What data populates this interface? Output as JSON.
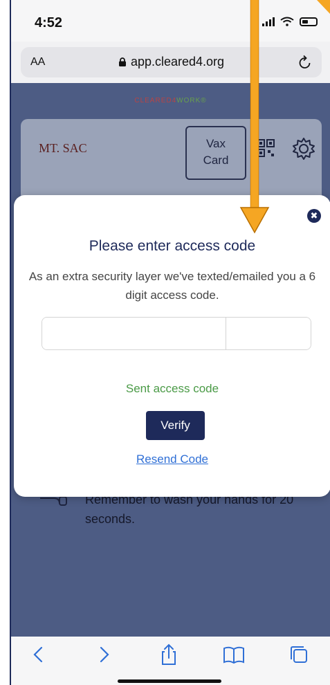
{
  "status_bar": {
    "time": "4:52"
  },
  "url_bar": {
    "text_size_label": "AA",
    "domain": "app.cleared4.org"
  },
  "page": {
    "brand": {
      "part1": "CLEARED4",
      "part2": "WORK",
      "mark": "®"
    },
    "logo": {
      "text": "MT. SAC"
    },
    "vax_card": {
      "line1": "Vax",
      "line2": "Card"
    },
    "tip": "Remember to wash your hands for 20 seconds."
  },
  "modal": {
    "close_glyph": "✖",
    "title": "Please enter access code",
    "subtitle": "As an extra security layer we've texted/emailed you a 6 digit access code.",
    "code_slots": [
      "",
      "",
      "",
      "",
      "",
      ""
    ],
    "sent_status": "Sent access code",
    "verify_label": "Verify",
    "resend_label": "Resend Code"
  },
  "colors": {
    "navy": "#1e2a5a",
    "overlay": "#4d5c84",
    "success": "#4a9a46",
    "link": "#2f6fd6",
    "annotation": "#f39a12"
  },
  "icons": [
    "lock-icon",
    "reload-icon",
    "qr-icon",
    "gear-icon",
    "close-icon",
    "back-icon",
    "forward-icon",
    "share-icon",
    "bookmarks-icon",
    "tabs-icon"
  ]
}
